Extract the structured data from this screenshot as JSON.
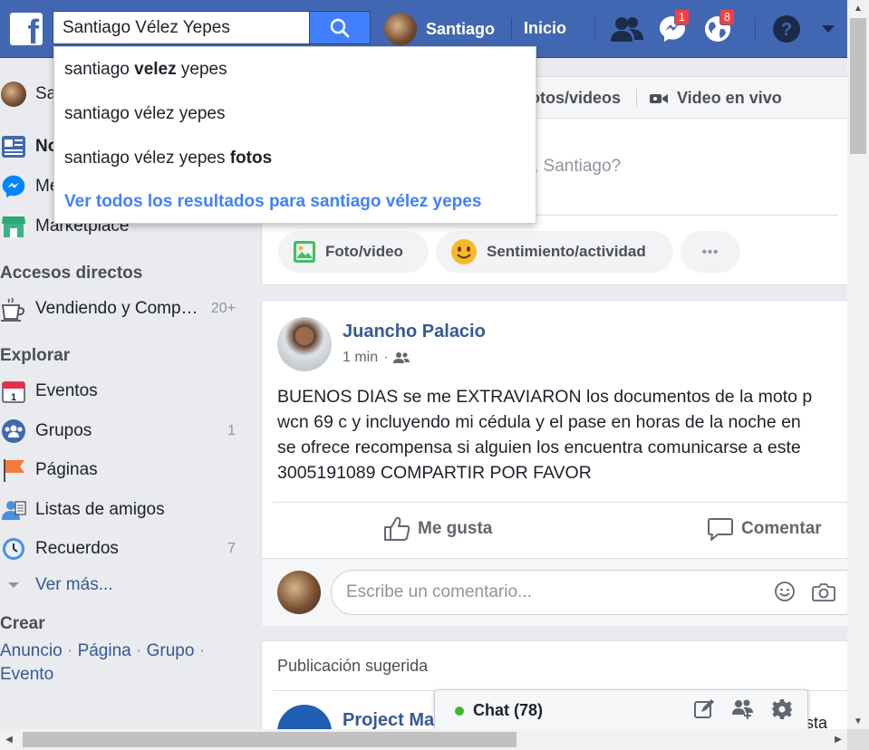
{
  "search": {
    "value": "Santiago Vélez Yepes"
  },
  "topbar": {
    "profile_name": "Santiago",
    "home_label": "Inicio",
    "messages_badge": "1",
    "notifications_badge": "8"
  },
  "dropdown": {
    "s1_a": "santiago ",
    "s1_b": "velez",
    "s1_c": " yepes",
    "s2": "santiago vélez yepes",
    "s3_a": "santiago vélez yepes ",
    "s3_b": "fotos",
    "all": "Ver todos los resultados para santiago vélez yepes"
  },
  "leftnav": {
    "profile": "Sa",
    "news": "No",
    "messenger": "Me",
    "marketplace": "Marketplace",
    "shortcuts_heading": "Accesos directos",
    "shortcut_1": "Vendiendo y Comp…",
    "shortcut_1_count": "20+",
    "explore_heading": "Explorar",
    "events": "Eventos",
    "groups": "Grupos",
    "groups_count": "1",
    "pages": "Páginas",
    "friend_lists": "Listas de amigos",
    "memories": "Recuerdos",
    "memories_count": "7",
    "see_more": "Ver más...",
    "create_heading": "Crear",
    "create_ad": "Anuncio",
    "create_page": "Página",
    "create_group": "Grupo",
    "create_event": "Evento"
  },
  "composer": {
    "tab_photos": "otos/videos",
    "tab_live": "Video en vivo",
    "placeholder": ", Santiago?",
    "photo_video": "Foto/video",
    "feeling": "Sentimiento/actividad",
    "more": "•••"
  },
  "post": {
    "author": "Juancho Palacio",
    "time": "1 min",
    "lines": [
      "BUENOS DIAS se me EXTRAVIARON los documentos de la moto p",
      "wcn 69 c y incluyendo mi cédula y el pase en horas de la noche en",
      "se ofrece recompensa si alguien los encuentra comunicarse a este",
      "3005191089 COMPARTIR POR FAVOR"
    ],
    "like": "Me gusta",
    "comment": "Comentar",
    "comment_placeholder": "Escribe un comentario..."
  },
  "suggested": {
    "title": "Publicación sugerida",
    "author": "Project Ma",
    "trail": "sta pá"
  },
  "chat": {
    "label": "Chat (78)"
  }
}
